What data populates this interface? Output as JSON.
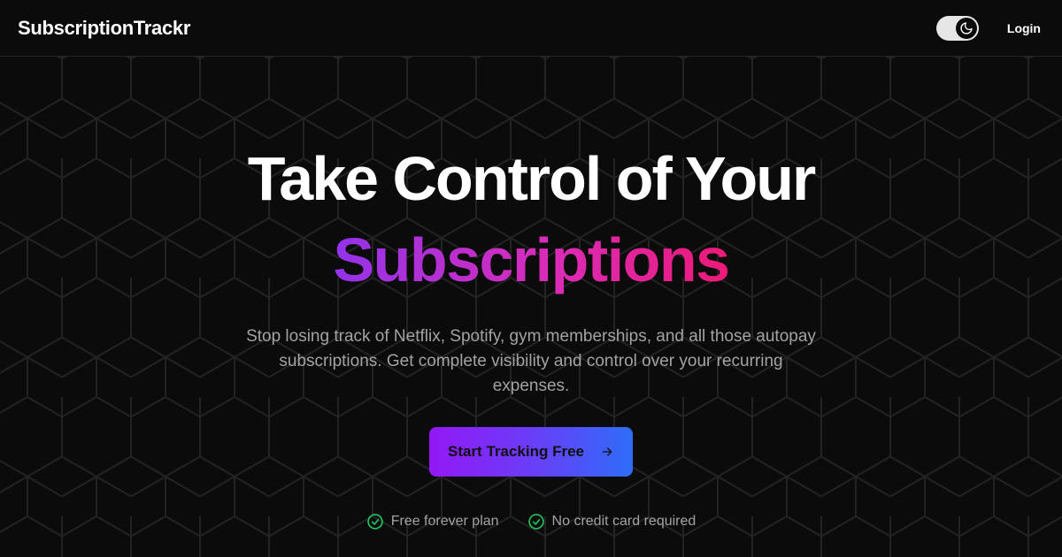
{
  "nav": {
    "brand": "SubscriptionTrackr",
    "login": "Login",
    "theme_toggle_icon": "moon-icon"
  },
  "hero": {
    "headline_line1": "Take Control of Your",
    "headline_line2": "Subscriptions",
    "subtitle": "Stop losing track of Netflix, Spotify, gym memberships, and all those autopay subscriptions. Get complete visibility and control over your recurring expenses.",
    "cta_label": "Start Tracking Free",
    "cta_icon": "arrow-right-icon",
    "features": [
      {
        "label": "Free forever plan",
        "icon": "check-circle-icon"
      },
      {
        "label": "No credit card required",
        "icon": "check-circle-icon"
      }
    ]
  },
  "colors": {
    "background": "#0b0b0b",
    "accent_gradient": [
      "#9333ea",
      "#ec1a76"
    ],
    "cta_gradient": [
      "#9318f5",
      "#2f6df8"
    ],
    "check_color": "#22c55e"
  }
}
